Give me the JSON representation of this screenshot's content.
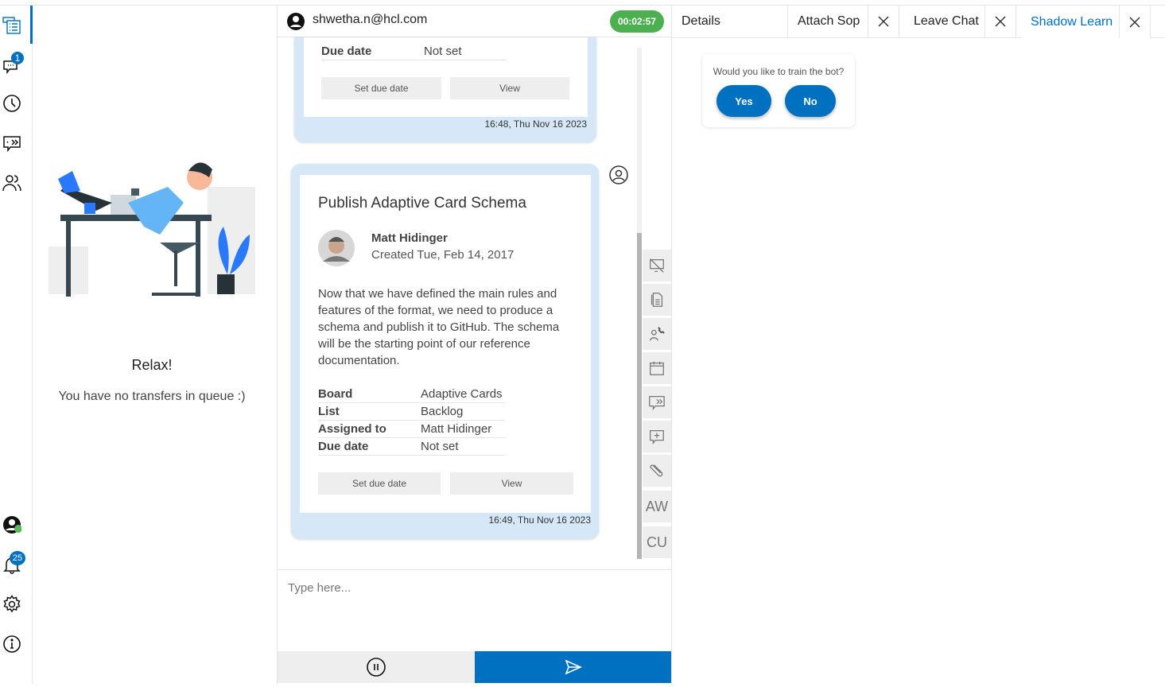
{
  "rail": {
    "chat_badge": "1",
    "notification_badge": "25",
    "accent": "#0070c0"
  },
  "queue": {
    "title": "Relax!",
    "message": "You have no transfers in queue :)"
  },
  "chat": {
    "user_email": "shwetha.n@hcl.com",
    "timer": "00:02:57",
    "messages": [
      {
        "facts": [
          {
            "label": "Due date",
            "value": "Not set"
          }
        ],
        "actions": [
          "Set due date",
          "View"
        ],
        "timestamp": "16:48, Thu Nov 16 2023"
      },
      {
        "title": "Publish Adaptive Card Schema",
        "author": "Matt Hidinger",
        "created": "Created Tue, Feb 14, 2017",
        "body": "Now that we have defined the main rules and features of the format, we need to produce a schema and publish it to GitHub. The schema will be the starting point of our reference documentation.",
        "facts": [
          {
            "label": "Board",
            "value": "Adaptive Cards"
          },
          {
            "label": "List",
            "value": "Backlog"
          },
          {
            "label": "Assigned to",
            "value": "Matt Hidinger"
          },
          {
            "label": "Due date",
            "value": "Not set"
          }
        ],
        "actions": [
          "Set due date",
          "View"
        ],
        "timestamp": "16:49, Thu Nov 16 2023"
      }
    ],
    "tools": [
      "AW",
      "CU"
    ],
    "composer_placeholder": "Type here..."
  },
  "right": {
    "tabs": [
      "Details",
      "Attach Sop",
      "Leave Chat",
      "Shadow Learn"
    ],
    "train_question": "Would you like to train the bot?",
    "yes": "Yes",
    "no": "No"
  }
}
